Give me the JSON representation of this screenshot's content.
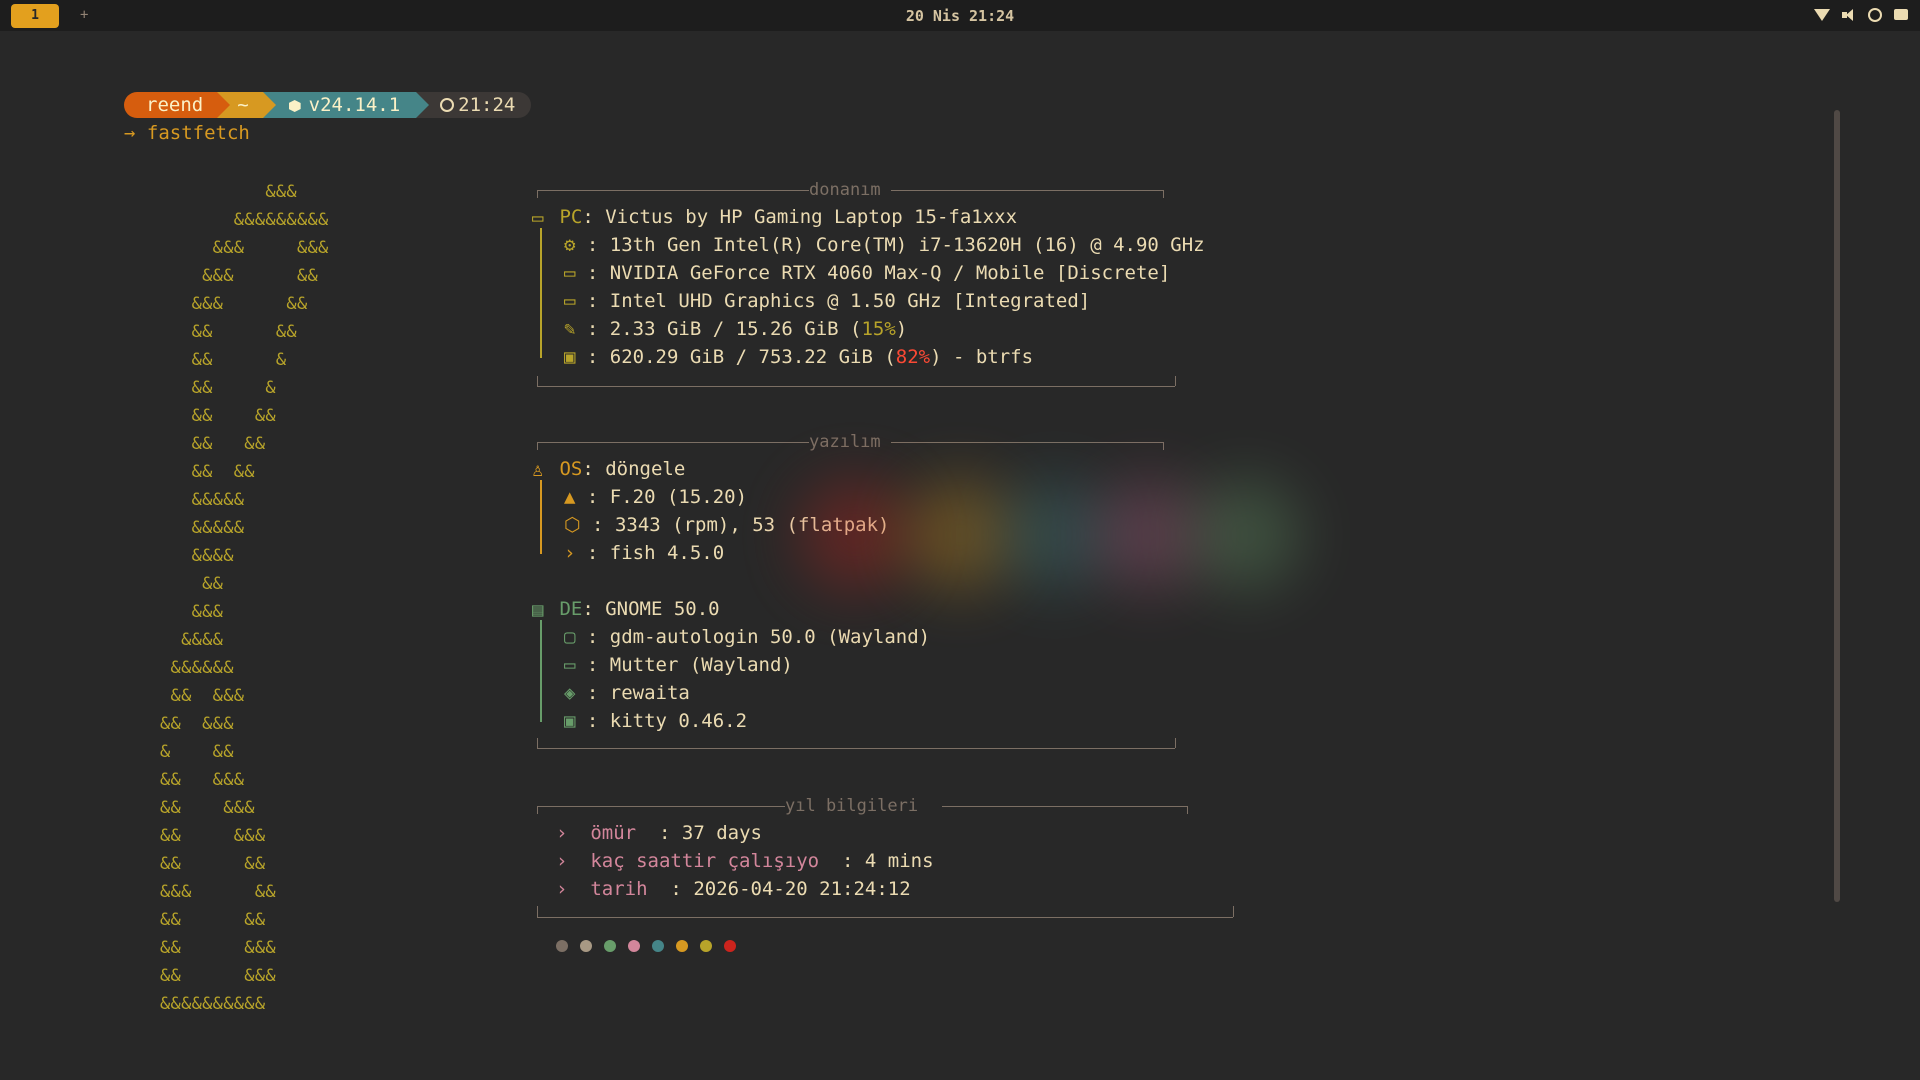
{
  "topbar": {
    "workspace_active": "1",
    "workspace_add": "+",
    "datetime": "20 Nis 21:24"
  },
  "prompt": {
    "user": "reend",
    "dir": "~",
    "node": "v24.14.1",
    "time": "21:24",
    "command_arrow": "→",
    "command": "fastfetch"
  },
  "logo": {
    "ascii": "          &&&\n       &&&&&&&&&\n     &&&     &&&\n    &&&      &&\n   &&&      &&\n   &&      &&\n   &&      &\n   &&     &\n   &&    &&\n   &&   &&\n   &&  &&\n   &&&&&\n   &&&&&\n   &&&&\n    &&\n   &&&\n  &&&&\n &&&&&&\n &&  &&&\n&&  &&&\n&    &&\n&&   &&&\n&&    &&&\n&&     &&&\n&&      &&\n&&&      &&\n&&      &&\n&&      &&&\n&&      &&&\n&&&&&&&&&&",
    "color": "#b8a42a"
  },
  "hardware": {
    "title": "donanım",
    "pc_label": "PC",
    "pc_value": "Victus by HP Gaming Laptop 15-fa1xxx",
    "cpu": "13th Gen Intel(R) Core(TM) i7-13620H (16) @ 4.90 GHz",
    "gpu1": "NVIDIA GeForce RTX 4060 Max-Q / Mobile [Discrete]",
    "gpu2": "Intel UHD Graphics @ 1.50 GHz [Integrated]",
    "memory_pre": "2.33 GiB / 15.26 GiB (",
    "memory_pct": "15%",
    "memory_post": ")",
    "disk_pre": "620.29 GiB / 753.22 GiB (",
    "disk_pct": "82%",
    "disk_post": ") - btrfs"
  },
  "software": {
    "title": "yazılım",
    "os_label": "OS",
    "os_value": "döngele",
    "os_version": "F.20 (15.20)",
    "packages": "3343 (rpm), 53 (flatpak)",
    "shell": "fish 4.5.0",
    "de_label": "DE",
    "de_value": "GNOME 50.0",
    "login_manager": "gdm-autologin 50.0 (Wayland)",
    "wm": "Mutter (Wayland)",
    "theme": "rewaita",
    "terminal": "kitty 0.46.2"
  },
  "year_info": {
    "title": "yıl bilgileri",
    "bullet": "›",
    "rows": [
      {
        "key": "ömür",
        "sep": "  : ",
        "value": "37 days"
      },
      {
        "key": "kaç saattir çalışıyo",
        "sep": "  : ",
        "value": "4 mins"
      },
      {
        "key": "tarih",
        "sep": "  : ",
        "value": "2026-04-20 21:24:12"
      }
    ]
  },
  "colors": {
    "dots": [
      "#7c6f64",
      "#a89984",
      "#689d6a",
      "#d3869b",
      "#458588",
      "#d79921",
      "#b8a42a",
      "#cc241d"
    ],
    "hardware_accent": "#b8a42a",
    "software_accent": "#d79921",
    "de_accent": "#689d6a",
    "year_accent": "#d3869b"
  }
}
